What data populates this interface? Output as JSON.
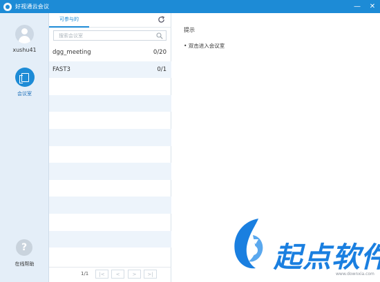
{
  "window": {
    "title": "好视通云会议",
    "minimize_glyph": "—",
    "close_glyph": "✕"
  },
  "sidebar": {
    "username": "xushu41",
    "meeting_label": "会议室",
    "help_glyph": "?",
    "help_label": "在线帮助"
  },
  "list_panel": {
    "tab_label": "可参与的",
    "search_placeholder": "搜索会议室",
    "rows": [
      {
        "name": "dgg_meeting",
        "count": "0/20"
      },
      {
        "name": "FAST3",
        "count": "0/1"
      }
    ],
    "pager": {
      "page_info": "1/1",
      "first_glyph": "|<",
      "prev_glyph": "<",
      "next_glyph": ">",
      "last_glyph": ">|"
    }
  },
  "content": {
    "hint_title": "提示",
    "hint_item": "• 双击进入会议室"
  },
  "watermark": {
    "brand": "起点软件",
    "url": "www.downxia.com"
  },
  "colors": {
    "accent": "#1d8bd6",
    "sidebar_bg": "#e4eef8",
    "row_alt": "#edf4fb"
  }
}
